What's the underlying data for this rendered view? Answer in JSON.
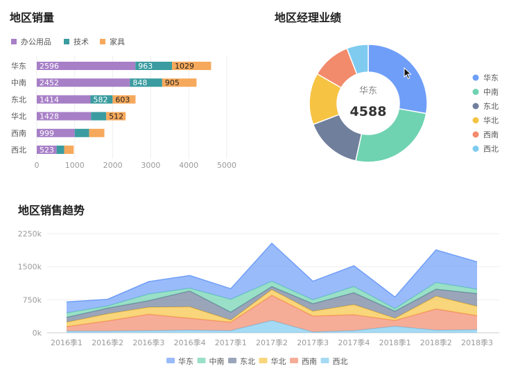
{
  "sales_by_region": {
    "title": "地区销量",
    "legend": [
      {
        "name": "办公用品",
        "color": "#a77fc7"
      },
      {
        "name": "技术",
        "color": "#3a9ca0"
      },
      {
        "name": "家具",
        "color": "#f6a95c"
      }
    ]
  },
  "manager_performance": {
    "title": "地区经理业绩",
    "center_label": "华东",
    "center_value": "4588",
    "legend": [
      {
        "name": "华东",
        "color": "#6f9ef8"
      },
      {
        "name": "中南",
        "color": "#6fd3b1"
      },
      {
        "name": "东北",
        "color": "#6f7f9c"
      },
      {
        "name": "华北",
        "color": "#f6c343"
      },
      {
        "name": "西南",
        "color": "#f28a6c"
      },
      {
        "name": "西北",
        "color": "#7fcbf0"
      }
    ]
  },
  "sales_trend": {
    "title": "地区销售趋势"
  },
  "chart_data": [
    {
      "type": "bar",
      "orientation": "horizontal",
      "stacked": true,
      "title": "地区销量",
      "categories": [
        "华东",
        "中南",
        "东北",
        "华北",
        "西南",
        "西北"
      ],
      "series": [
        {
          "name": "办公用品",
          "color": "#a77fc7",
          "values": [
            2596,
            2452,
            1414,
            1428,
            999,
            523
          ]
        },
        {
          "name": "技术",
          "color": "#3a9ca0",
          "values": [
            963,
            848,
            582,
            400,
            380,
            200
          ]
        },
        {
          "name": "家具",
          "color": "#f6a95c",
          "values": [
            1029,
            905,
            603,
            512,
            400,
            250
          ]
        }
      ],
      "data_labels": [
        [
          "2596",
          "963",
          "1029"
        ],
        [
          "2452",
          "848",
          "905"
        ],
        [
          "1414",
          "582",
          "603"
        ],
        [
          "1428",
          "",
          "512"
        ],
        [
          "999",
          "",
          ""
        ],
        [
          "523",
          "",
          ""
        ]
      ],
      "xlim": [
        0,
        5000
      ],
      "xticks": [
        "0",
        "1000",
        "2000",
        "3000",
        "4000",
        "5000"
      ],
      "legend_position": "top-left"
    },
    {
      "type": "pie",
      "donut": true,
      "title": "地区经理业绩",
      "labels": [
        "华东",
        "中南",
        "东北",
        "华北",
        "西南",
        "西北"
      ],
      "colors": [
        "#6f9ef8",
        "#6fd3b1",
        "#6f7f9c",
        "#f6c343",
        "#f28a6c",
        "#7fcbf0"
      ],
      "values": [
        4588,
        4235,
        2599,
        2340,
        1781,
        973
      ],
      "center_label": "华东",
      "center_value": "4588",
      "legend_position": "right"
    },
    {
      "type": "area",
      "stacked": true,
      "title": "地区销售趋势",
      "x": [
        "2016季1",
        "2016季2",
        "2016季3",
        "2016季4",
        "2017季1",
        "2017季2",
        "2017季3",
        "2017季4",
        "2018季1",
        "2018季2",
        "2018季3"
      ],
      "series": [
        {
          "name": "西北",
          "color": "#7fcbf0",
          "values": [
            40000,
            40000,
            50000,
            60000,
            50000,
            280000,
            20000,
            50000,
            150000,
            60000,
            70000
          ]
        },
        {
          "name": "西南",
          "color": "#f28a6c",
          "values": [
            100000,
            230000,
            370000,
            270000,
            190000,
            570000,
            360000,
            360000,
            130000,
            480000,
            320000
          ]
        },
        {
          "name": "华北",
          "color": "#f6c343",
          "values": [
            100000,
            160000,
            160000,
            260000,
            50000,
            130000,
            110000,
            230000,
            50000,
            290000,
            210000
          ]
        },
        {
          "name": "东北",
          "color": "#6f7f9c",
          "values": [
            110000,
            130000,
            150000,
            360000,
            180000,
            70000,
            170000,
            270000,
            160000,
            160000,
            290000
          ]
        },
        {
          "name": "中南",
          "color": "#6fd3b1",
          "values": [
            100000,
            50000,
            150000,
            60000,
            290000,
            120000,
            90000,
            140000,
            60000,
            150000,
            100000
          ]
        },
        {
          "name": "华东",
          "color": "#6f9ef8",
          "values": [
            250000,
            150000,
            280000,
            290000,
            240000,
            860000,
            420000,
            470000,
            260000,
            740000,
            620000
          ]
        }
      ],
      "legend_order": [
        "华东",
        "中南",
        "东北",
        "华北",
        "西南",
        "西北"
      ],
      "ylim": [
        0,
        2250000
      ],
      "yticks": [
        "0k",
        "750k",
        "1500k",
        "2250k"
      ],
      "legend_position": "bottom"
    }
  ]
}
